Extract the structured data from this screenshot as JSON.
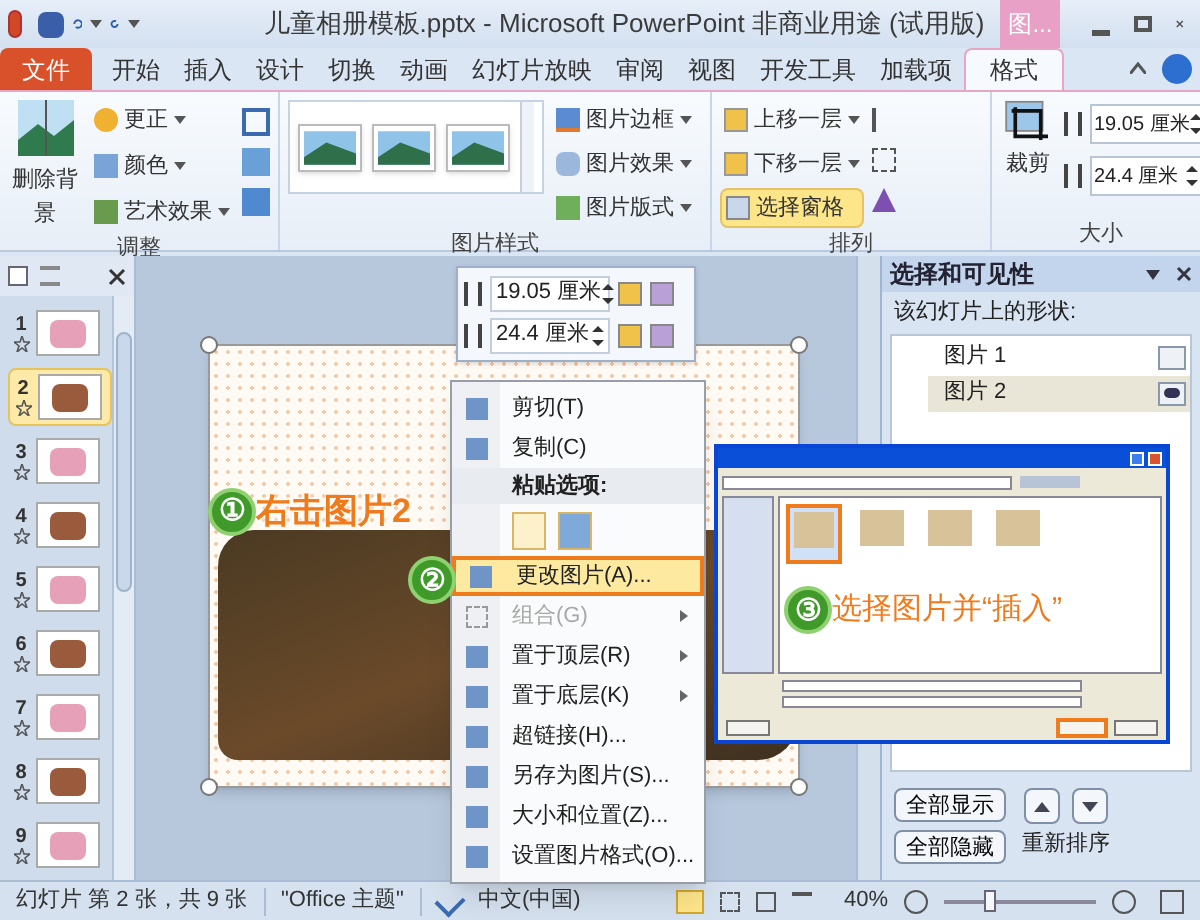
{
  "title_bar": {
    "title": "儿童相册模板.pptx - Microsoft PowerPoint 非商业用途 (试用版)",
    "context_tab": "图..."
  },
  "ribbon_tabs": [
    {
      "label": "文件",
      "kind": "file",
      "selected": false
    },
    {
      "label": "开始",
      "kind": "tab",
      "selected": false
    },
    {
      "label": "插入",
      "kind": "tab",
      "selected": false
    },
    {
      "label": "设计",
      "kind": "tab",
      "selected": false
    },
    {
      "label": "切换",
      "kind": "tab",
      "selected": false
    },
    {
      "label": "动画",
      "kind": "tab",
      "selected": false
    },
    {
      "label": "幻灯片放映",
      "kind": "tab",
      "selected": false
    },
    {
      "label": "审阅",
      "kind": "tab",
      "selected": false
    },
    {
      "label": "视图",
      "kind": "tab",
      "selected": false
    },
    {
      "label": "开发工具",
      "kind": "tab",
      "selected": false
    },
    {
      "label": "加载项",
      "kind": "tab",
      "selected": false
    },
    {
      "label": "格式",
      "kind": "tab",
      "selected": true
    }
  ],
  "ribbon": {
    "adjust": {
      "label": "调整",
      "remove_background": "删除背景",
      "items": [
        "更正",
        "颜色",
        "艺术效果"
      ]
    },
    "picture_styles": {
      "label": "图片样式",
      "items": [
        "图片边框",
        "图片效果",
        "图片版式"
      ]
    },
    "arrange": {
      "label": "排列",
      "items": [
        {
          "label": "上移一层",
          "selected": false
        },
        {
          "label": "下移一层",
          "selected": false
        },
        {
          "label": "选择窗格",
          "selected": true
        }
      ]
    },
    "size": {
      "label": "大小",
      "crop": "裁剪",
      "height": "19.05 厘米",
      "width": "24.4 厘米"
    }
  },
  "slides": [
    {
      "number": "1",
      "selected": false
    },
    {
      "number": "2",
      "selected": true
    },
    {
      "number": "3",
      "selected": false
    },
    {
      "number": "4",
      "selected": false
    },
    {
      "number": "5",
      "selected": false
    },
    {
      "number": "6",
      "selected": false
    },
    {
      "number": "7",
      "selected": false
    },
    {
      "number": "8",
      "selected": false
    },
    {
      "number": "9",
      "selected": false
    }
  ],
  "mini_toolbar": {
    "height": "19.05 厘米",
    "width": "24.4 厘米"
  },
  "context_menu": [
    {
      "kind": "item",
      "label": "剪切(T)",
      "selected": false,
      "disabled": false,
      "submenu": false
    },
    {
      "kind": "item",
      "label": "复制(C)",
      "selected": false,
      "disabled": false,
      "submenu": false
    },
    {
      "kind": "header",
      "label": "粘贴选项:"
    },
    {
      "kind": "paste"
    },
    {
      "kind": "item",
      "label": "更改图片(A)...",
      "selected": true,
      "disabled": false,
      "submenu": false
    },
    {
      "kind": "item",
      "label": "组合(G)",
      "selected": false,
      "disabled": true,
      "submenu": true
    },
    {
      "kind": "item",
      "label": "置于顶层(R)",
      "selected": false,
      "disabled": false,
      "submenu": true
    },
    {
      "kind": "item",
      "label": "置于底层(K)",
      "selected": false,
      "disabled": false,
      "submenu": true
    },
    {
      "kind": "item",
      "label": "超链接(H)...",
      "selected": false,
      "disabled": false,
      "submenu": false
    },
    {
      "kind": "item",
      "label": "另存为图片(S)...",
      "selected": false,
      "disabled": false,
      "submenu": false
    },
    {
      "kind": "item",
      "label": "大小和位置(Z)...",
      "selected": false,
      "disabled": false,
      "submenu": false
    },
    {
      "kind": "item",
      "label": "设置图片格式(O)...",
      "selected": false,
      "disabled": false,
      "submenu": false
    }
  ],
  "annotations": [
    {
      "number": "①",
      "text": "右击图片2"
    },
    {
      "number": "②"
    },
    {
      "number": "③",
      "text": "选择图片并“插入”"
    }
  ],
  "insert_dialog": {
    "files": [
      {
        "selected": true
      },
      {
        "selected": false
      },
      {
        "selected": false
      },
      {
        "selected": false
      }
    ]
  },
  "selection_pane": {
    "title": "选择和可见性",
    "subtitle": "该幻灯片上的形状:",
    "shapes": [
      {
        "label": "图片 1",
        "selected": false,
        "visible": false
      },
      {
        "label": "图片 2",
        "selected": true,
        "visible": true
      }
    ],
    "show_all": "全部显示",
    "hide_all": "全部隐藏",
    "reorder": "重新排序"
  },
  "status_bar": {
    "slide_info": "幻灯片 第 2 张，共 9 张",
    "theme": "\"Office 主题\"",
    "language": "中文(中国)",
    "zoom": "40%",
    "zoom_slider": {
      "level": 0.3
    }
  }
}
